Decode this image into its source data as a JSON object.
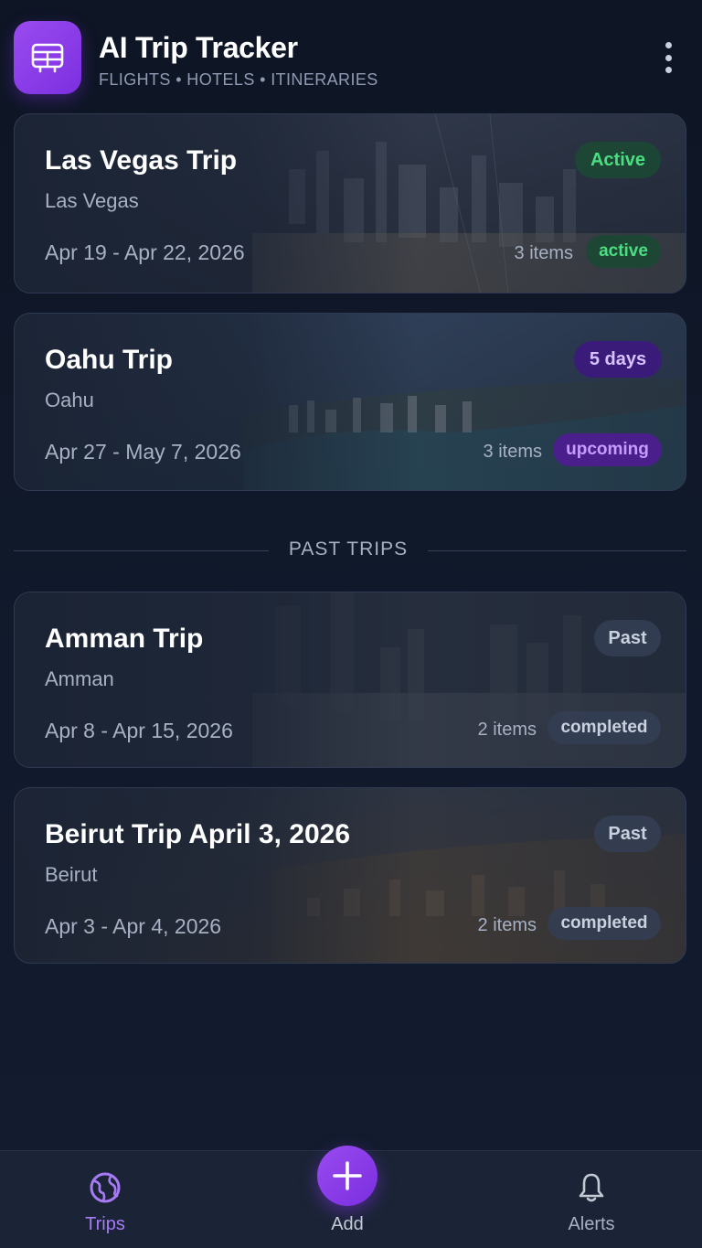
{
  "app": {
    "title": "AI Trip Tracker",
    "subtitle": "FLIGHTS • HOTELS • ITINERARIES",
    "logo_icon": "luggage-icon",
    "accent": "#8b3ff0"
  },
  "trips": [
    {
      "name": "Las Vegas Trip",
      "city": "Las Vegas",
      "dates": "Apr 19 - Apr 22, 2026",
      "badge": "Active",
      "items": "3 items",
      "status": "active"
    },
    {
      "name": "Oahu Trip",
      "city": "Oahu",
      "dates": "Apr 27 - May 7, 2026",
      "badge": "5 days",
      "items": "3 items",
      "status": "upcoming"
    }
  ],
  "past_section": {
    "label": "PAST TRIPS"
  },
  "past_trips": [
    {
      "name": "Amman Trip",
      "city": "Amman",
      "dates": "Apr 8 - Apr 15, 2026",
      "badge": "Past",
      "items": "2 items",
      "status": "completed"
    },
    {
      "name": "Beirut Trip April 3, 2026",
      "city": "Beirut",
      "dates": "Apr 3 - Apr 4, 2026",
      "badge": "Past",
      "items": "2 items",
      "status": "completed"
    }
  ],
  "nav": {
    "trips_label": "Trips",
    "add_label": "Add",
    "alerts_label": "Alerts",
    "trips_icon": "globe-icon",
    "add_icon": "plus-icon",
    "alerts_icon": "bell-icon"
  }
}
